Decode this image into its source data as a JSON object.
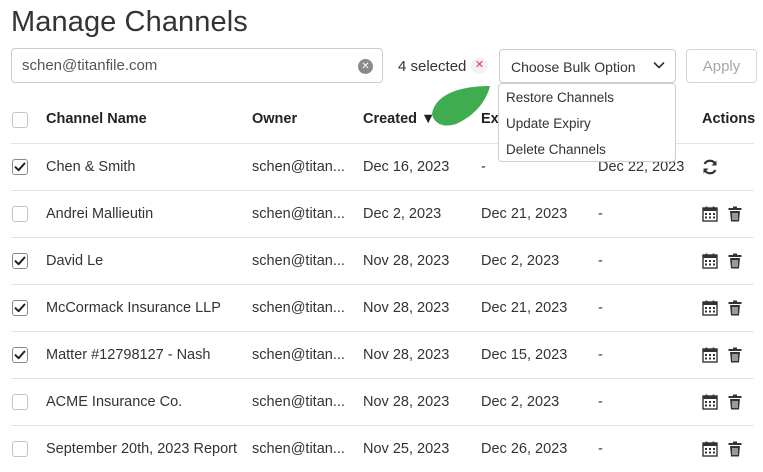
{
  "page": {
    "title": "Manage Channels"
  },
  "search": {
    "value": "schen@titanfile.com",
    "clear_icon": "x-circle-icon"
  },
  "selection": {
    "text": "4 selected",
    "clear_icon": "x-icon"
  },
  "bulk": {
    "placeholder": "Choose Bulk Option",
    "options": [
      "Restore Channels",
      "Update Expiry",
      "Delete Channels"
    ]
  },
  "apply_label": "Apply",
  "table": {
    "headers": {
      "name": "Channel Name",
      "owner": "Owner",
      "created": "Created ▼",
      "expires": "Ex",
      "actions": "Actions"
    },
    "rows": [
      {
        "checked": true,
        "name": "Chen & Smith",
        "owner": "schen@titan...",
        "created": "Dec 16, 2023",
        "expires": "-",
        "deleted": "Dec 22, 2023",
        "actions": [
          "restore"
        ]
      },
      {
        "checked": false,
        "name": "Andrei Mallieutin",
        "owner": "schen@titan...",
        "created": "Dec 2, 2023",
        "expires": "Dec 21, 2023",
        "deleted": "-",
        "actions": [
          "calendar",
          "trash"
        ]
      },
      {
        "checked": true,
        "name": "David Le",
        "owner": "schen@titan...",
        "created": "Nov 28, 2023",
        "expires": "Dec 2, 2023",
        "deleted": "-",
        "actions": [
          "calendar",
          "trash"
        ]
      },
      {
        "checked": true,
        "name": "McCormack Insurance LLP",
        "owner": "schen@titan...",
        "created": "Nov 28, 2023",
        "expires": "Dec 21, 2023",
        "deleted": "-",
        "actions": [
          "calendar",
          "trash"
        ]
      },
      {
        "checked": true,
        "name": "Matter #12798127 - Nash",
        "owner": "schen@titan...",
        "created": "Nov 28, 2023",
        "expires": "Dec 15, 2023",
        "deleted": "-",
        "actions": [
          "calendar",
          "trash"
        ]
      },
      {
        "checked": false,
        "name": "ACME Insurance Co.",
        "owner": "schen@titan...",
        "created": "Nov 28, 2023",
        "expires": "Dec 2, 2023",
        "deleted": "-",
        "actions": [
          "calendar",
          "trash"
        ]
      },
      {
        "checked": false,
        "name": "September 20th, 2023 Report",
        "owner": "schen@titan...",
        "created": "Nov 25, 2023",
        "expires": "Dec 26, 2023",
        "deleted": "-",
        "actions": [
          "calendar",
          "trash"
        ]
      }
    ]
  },
  "colors": {
    "accent_green": "#3fad4f",
    "danger_red": "#e0383e",
    "border": "#cccccc"
  }
}
